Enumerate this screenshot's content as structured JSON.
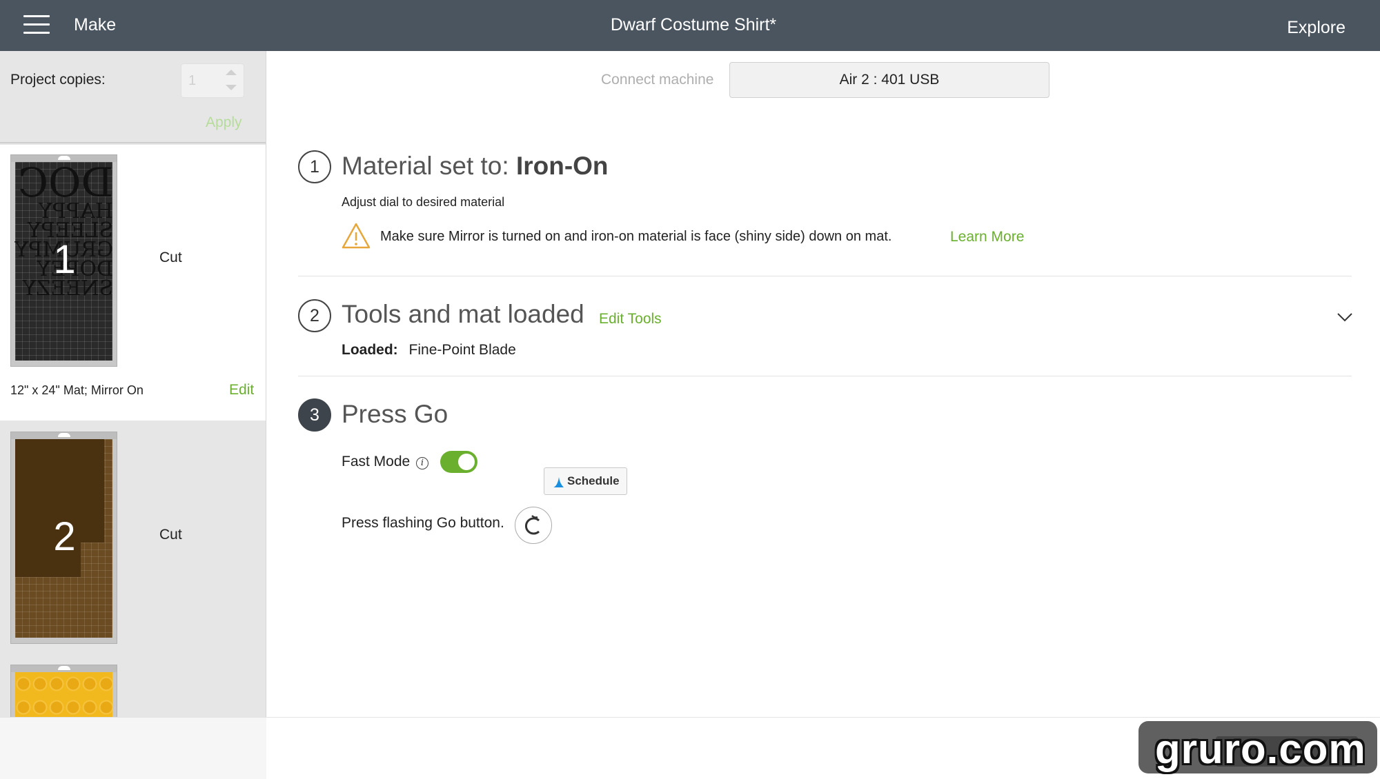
{
  "header": {
    "make_label": "Make",
    "title": "Dwarf Costume Shirt*",
    "explore_label": "Explore"
  },
  "sidebar": {
    "project_copies_label": "Project copies:",
    "copies_value": "1",
    "apply_label": "Apply",
    "mats": [
      {
        "number": "1",
        "action": "Cut",
        "description": "12\" x 24\" Mat; Mirror On",
        "edit_label": "Edit",
        "art_words": [
          "DOC",
          "HAPPY",
          "SLEEPY",
          "GRUMPY",
          "DOPEY",
          "SNEEZY"
        ]
      },
      {
        "number": "2",
        "action": "Cut"
      }
    ]
  },
  "machine": {
    "connect_label": "Connect machine",
    "selected": "Air 2 : 401 USB"
  },
  "steps": [
    {
      "number": "1",
      "title_prefix": "Material set to: ",
      "title_value": "Iron-On",
      "subtitle": "Adjust dial to desired material",
      "warning": "Make sure Mirror is turned on and iron-on material is face (shiny side) down on mat.",
      "learn_more_label": "Learn More"
    },
    {
      "number": "2",
      "title": "Tools and mat loaded",
      "edit_tools_label": "Edit Tools",
      "loaded_label": "Loaded:",
      "loaded_value": "Fine-Point Blade"
    },
    {
      "number": "3",
      "title": "Press Go",
      "fast_mode_label": "Fast Mode",
      "fast_mode_on": true,
      "schedule_label": "Schedule",
      "press_text": "Press flashing Go button."
    }
  ],
  "watermark": "gruro.com",
  "colors": {
    "header_bg": "#4b5560",
    "accent_green": "#6ab02e",
    "sidebar_bg": "#e6e6e6"
  }
}
